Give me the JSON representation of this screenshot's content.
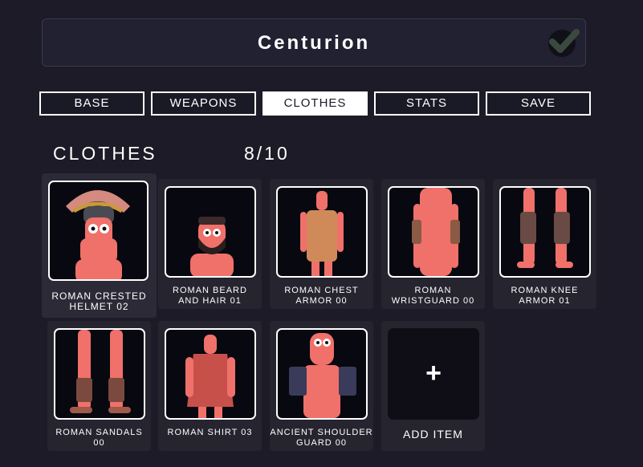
{
  "header": {
    "unit_name": "Centurion",
    "confirm_icon": "checkmark-icon"
  },
  "tabs": [
    {
      "label": "BASE",
      "active": false
    },
    {
      "label": "WEAPONS",
      "active": false
    },
    {
      "label": "CLOTHES",
      "active": true
    },
    {
      "label": "STATS",
      "active": false
    },
    {
      "label": "SAVE",
      "active": false
    }
  ],
  "section": {
    "title": "CLOTHES",
    "count": "8/10"
  },
  "items": [
    {
      "label": "ROMAN CRESTED\nHELMET 02",
      "selected": true
    },
    {
      "label": "ROMAN BEARD\nAND HAIR 01"
    },
    {
      "label": "ROMAN CHEST\nARMOR 00"
    },
    {
      "label": "ROMAN\nWRISTGUARD 00"
    },
    {
      "label": "ROMAN KNEE\nARMOR 01"
    },
    {
      "label": "ROMAN SANDALS\n00"
    },
    {
      "label": "ROMAN SHIRT 03"
    },
    {
      "label": "ANCIENT SHOULDER\nGUARD 00"
    }
  ],
  "add_item": {
    "label": "ADD ITEM",
    "icon": "plus-icon"
  },
  "colors": {
    "background": "#1c1b27",
    "skin": "#f0706a",
    "active_tab": "#ffffff"
  }
}
